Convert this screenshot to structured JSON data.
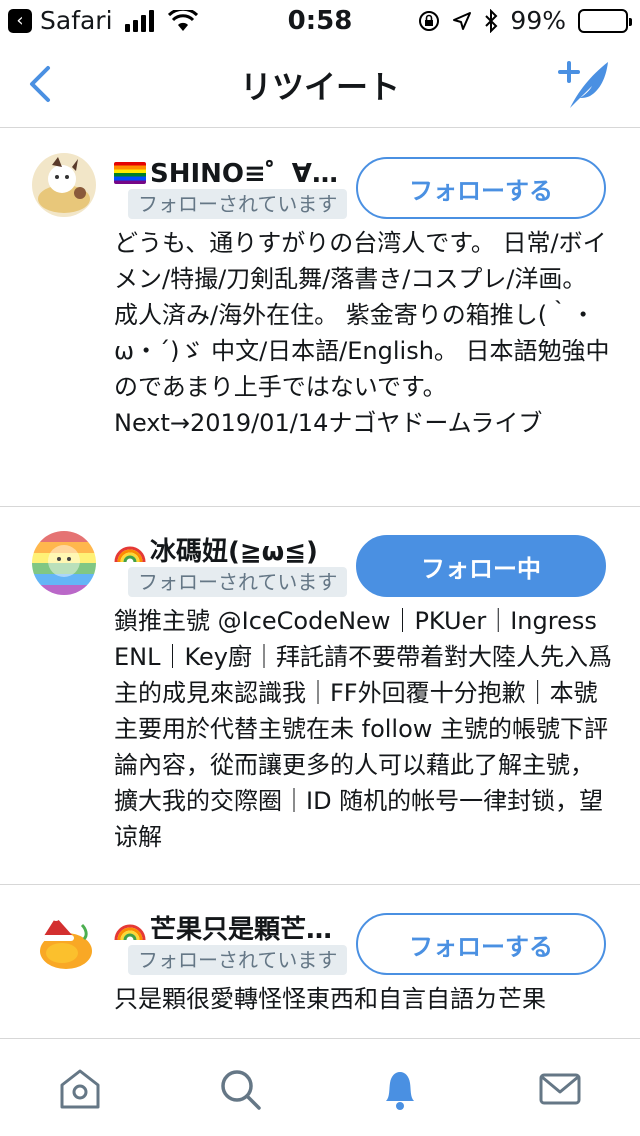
{
  "status_bar": {
    "back_app": "Safari",
    "time": "0:58",
    "battery": "99%"
  },
  "nav": {
    "title": "リツイート"
  },
  "users": [
    {
      "name": "SHINO≡゜∀゜…",
      "follows_you": "フォローされています",
      "button": "フォローする",
      "following": false,
      "bio": "どうも、通りすがりの台湾人です。 日常/ボイメン/特撮/刀剣乱舞/落書き/コスプレ/洋画。 成人済み/海外在住。 紫金寄りの箱推し(｀・ω・´)ゞ 中文/日本語/English。 日本語勉強中のであまり上手ではないです。 Next→2019/01/14ナゴヤドームライブ"
    },
    {
      "name": "冰碼妞(≧ω≦)",
      "follows_you": "フォローされています",
      "button": "フォロー中",
      "following": true,
      "bio": "鎖推主號 @IceCodeNew｜PKUer｜Ingress ENL｜Key廚｜拜託請不要帶着對大陸人先入爲主的成見來認識我｜FF外回覆十分抱歉｜本號主要用於代替主號在未 follow 主號的帳號下評論內容，從而讓更多的人可以藉此了解主號，擴大我的交際圈｜ID 随机的帐号一律封锁，望谅解"
    },
    {
      "name": "芒果只是顆芒…",
      "follows_you": "フォローされています",
      "button": "フォローする",
      "following": false,
      "bio": "只是顆很愛轉怪怪東西和自言自語ㄉ芒果"
    }
  ],
  "tabs": [
    "home-icon",
    "search-icon",
    "notifications-icon",
    "messages-icon"
  ],
  "colors": {
    "accent": "#4a90e2",
    "badge_bg": "#e6ecf0",
    "badge_text": "#657786",
    "divider": "#d7d7d7"
  }
}
